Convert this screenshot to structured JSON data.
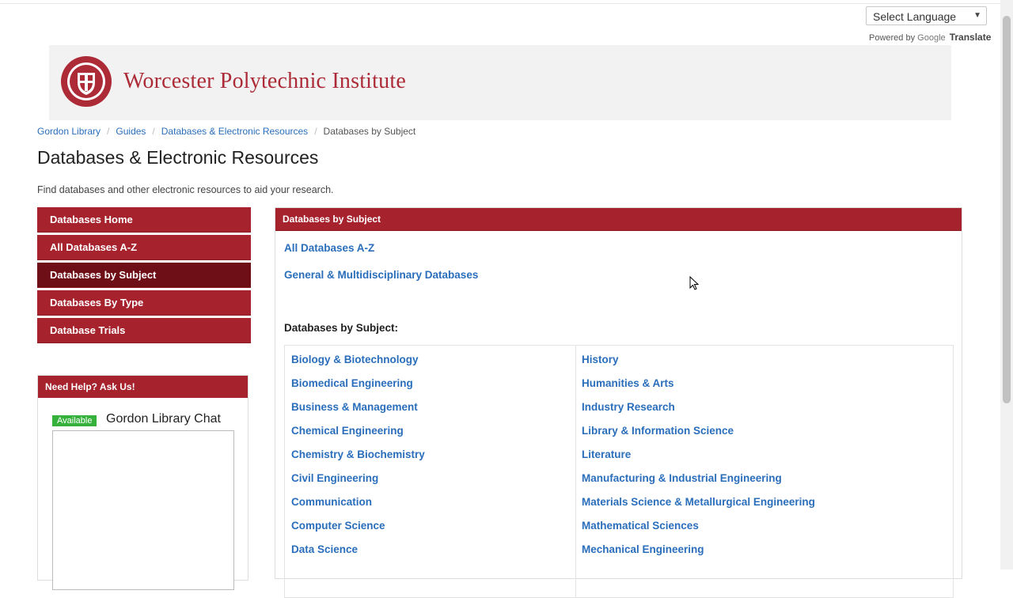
{
  "translate": {
    "select_label": "Select Language",
    "powered_by": "Powered by",
    "google": "Google",
    "translate": "Translate"
  },
  "header": {
    "institution": "Worcester Polytechnic Institute"
  },
  "breadcrumb": {
    "items": [
      "Gordon Library",
      "Guides",
      "Databases & Electronic Resources"
    ],
    "current": "Databases by Subject"
  },
  "page": {
    "title": "Databases & Electronic Resources",
    "description": "Find databases and other electronic resources to aid your research."
  },
  "nav": {
    "items": [
      {
        "label": "Databases Home"
      },
      {
        "label": "All Databases A-Z"
      },
      {
        "label": "Databases by Subject"
      },
      {
        "label": "Databases By Type"
      },
      {
        "label": "Database Trials"
      }
    ]
  },
  "help": {
    "header": "Need Help? Ask Us!",
    "status": "Available",
    "chat_title": "Gordon Library Chat"
  },
  "panel": {
    "header": "Databases by Subject",
    "link_all": "All Databases A-Z",
    "link_general": "General & Multidisciplinary Databases",
    "subheading": "Databases by Subject:",
    "left_column": [
      "Biology & Biotechnology",
      "Biomedical Engineering",
      "Business & Management",
      "Chemical Engineering",
      "Chemistry & Biochemistry",
      "Civil Engineering",
      "Communication",
      "Computer Science",
      "Data Science"
    ],
    "right_column": [
      "History",
      "Humanities & Arts",
      "Industry Research",
      "Library & Information Science",
      "Literature",
      "Manufacturing & Industrial Engineering",
      "Materials Science & Metallurgical Engineering",
      "Mathematical Sciences",
      "Mechanical Engineering"
    ]
  },
  "colors": {
    "brand_red": "#a6222d",
    "active_red": "#6e0f18",
    "link_blue": "#2a6ebb",
    "available_green": "#36b13b"
  }
}
